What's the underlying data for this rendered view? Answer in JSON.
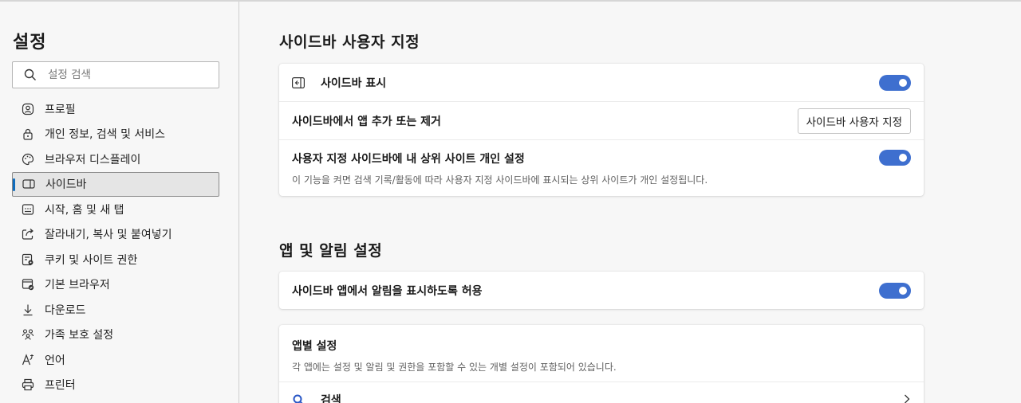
{
  "sidebar": {
    "title": "설정",
    "search_placeholder": "설정 검색",
    "items": [
      {
        "label": "프로필"
      },
      {
        "label": "개인 정보, 검색 및 서비스"
      },
      {
        "label": "브라우저 디스플레이"
      },
      {
        "label": "사이드바"
      },
      {
        "label": "시작, 홈 및 새 탭"
      },
      {
        "label": "잘라내기, 복사 및 붙여넣기"
      },
      {
        "label": "쿠키 및 사이트 권한"
      },
      {
        "label": "기본 브라우저"
      },
      {
        "label": "다운로드"
      },
      {
        "label": "가족 보호 설정"
      },
      {
        "label": "언어"
      },
      {
        "label": "프린터"
      }
    ]
  },
  "main": {
    "section1_title": "사이드바 사용자 지정",
    "show_sidebar_label": "사이드바 표시",
    "add_remove_label": "사이드바에서 앱 추가 또는 제거",
    "customize_button": "사이드바 사용자 지정",
    "personalize_label": "사용자 지정 사이드바에 내 상위 사이트 개인 설정",
    "personalize_desc": "이 기능을 켜면 검색 기록/활동에 따라 사용자 지정 사이드바에 표시되는 상위 사이트가 개인 설정됩니다.",
    "section2_title": "앱 및 알림 설정",
    "allow_notifications_label": "사이드바 앱에서 알림을 표시하도록 허용",
    "per_app_label": "앱별 설정",
    "per_app_desc": "각 앱에는 설정 및 알림 및 권한을 포함할 수 있는 개별 설정이 포함되어 있습니다.",
    "search_app_label": "검색"
  },
  "colors": {
    "accent": "#3e6fcf",
    "active_indicator": "#0f6cbd"
  }
}
